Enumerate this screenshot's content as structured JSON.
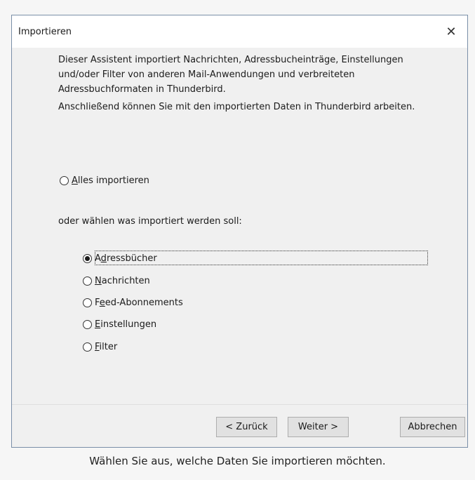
{
  "dialog": {
    "title": "Importieren",
    "close_symbol": "✕"
  },
  "intro": {
    "paragraph1": "Dieser Assistent importiert Nachrichten, Adressbucheinträge, Einstellungen und/oder Filter von anderen Mail-Anwendungen und verbreiteten Adressbuchformaten in Thunderbird.",
    "paragraph2": "Anschließend können Sie mit den importierten Daten in Thunderbird arbeiten."
  },
  "import_all": {
    "accesskey": "A",
    "rest": "lles importieren",
    "checked": false
  },
  "choose_label": "oder wählen was importiert werden soll:",
  "options": [
    {
      "before": "A",
      "accesskey": "d",
      "after": "ressbücher",
      "checked": true
    },
    {
      "before": "",
      "accesskey": "N",
      "after": "achrichten",
      "checked": false
    },
    {
      "before": "F",
      "accesskey": "e",
      "after": "ed-Abonnements",
      "checked": false
    },
    {
      "before": "",
      "accesskey": "E",
      "after": "instellungen",
      "checked": false
    },
    {
      "before": "",
      "accesskey": "F",
      "after": "ilter",
      "checked": false
    }
  ],
  "buttons": {
    "back": "< Zurück",
    "next": "Weiter >",
    "cancel": "Abbrechen"
  },
  "caption": "Wählen Sie aus, welche Daten Sie importieren möchten."
}
